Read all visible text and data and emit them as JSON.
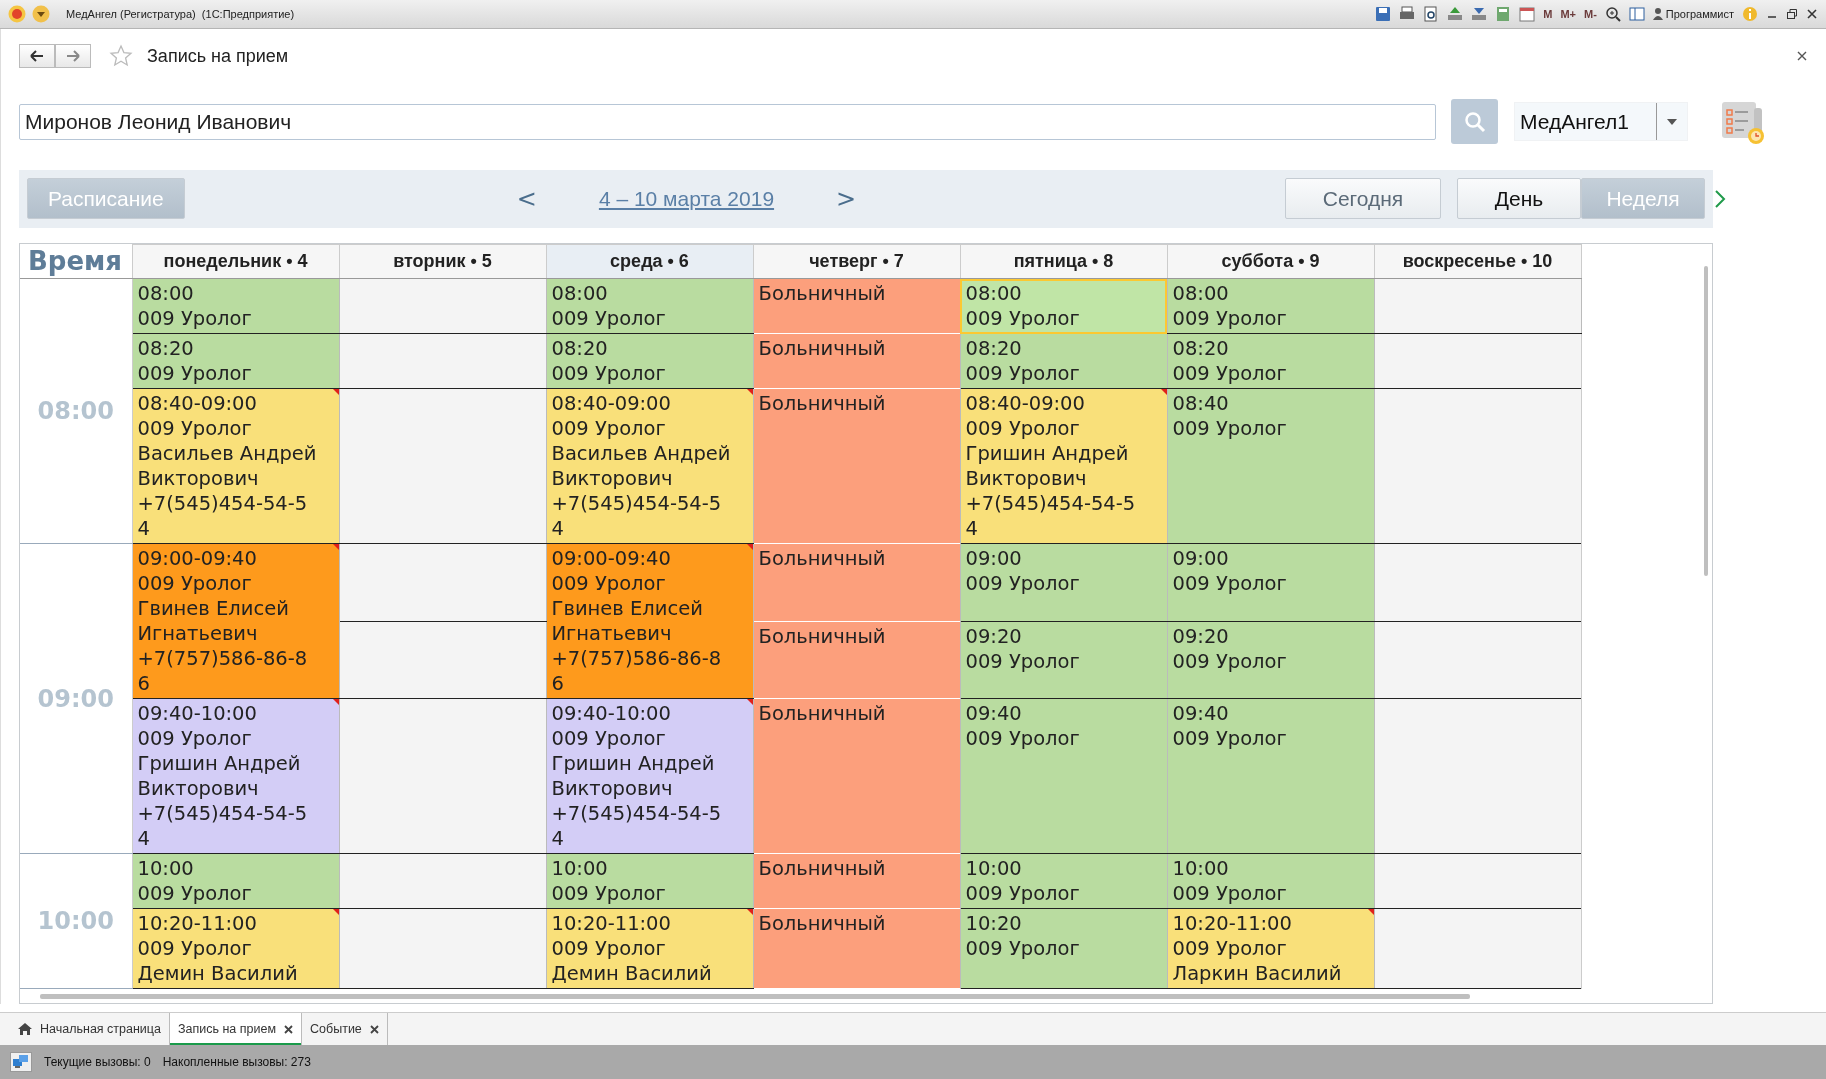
{
  "window": {
    "title": "МедАнгел (Регистратура)  (1С:Предприятие)",
    "memory_buttons": [
      "M",
      "M+",
      "M-"
    ],
    "user": "Программист"
  },
  "form": {
    "title": "Запись на прием"
  },
  "search": {
    "value": "Миронов Леонид Иванович"
  },
  "clinic": {
    "value": "МедАнгел1"
  },
  "toolbar": {
    "schedule_button": {
      "label": "Расписание",
      "pressed": true
    },
    "prev": "<",
    "period": "4 – 10 марта 2019",
    "next": ">",
    "today_button": "Сегодня",
    "views": [
      {
        "label": "День",
        "selected": false
      },
      {
        "label": "Неделя",
        "selected": true
      }
    ]
  },
  "calendar": {
    "time_header": "Время",
    "days": [
      {
        "label": "понедельник • 4",
        "today": false
      },
      {
        "label": "вторник • 5",
        "today": false
      },
      {
        "label": "среда • 6",
        "today": true
      },
      {
        "label": "четверг • 7",
        "today": false
      },
      {
        "label": "пятница • 8",
        "today": false
      },
      {
        "label": "суббота • 9",
        "today": false
      },
      {
        "label": "воскресенье • 10",
        "today": false
      }
    ],
    "rows": [
      {
        "hour": "08:00",
        "cells": [
          {
            "kind": "slot",
            "color": "#b9dca0",
            "lines": [
              "08:00",
              "009 Уролог"
            ],
            "flagged": false,
            "selected": false
          },
          {
            "kind": "empty",
            "selected": false
          },
          {
            "kind": "slot",
            "color": "#b9dca0",
            "lines": [
              "08:00",
              "009 Уролог"
            ],
            "flagged": false,
            "selected": false
          },
          {
            "kind": "absence",
            "color": "#fc9f7c",
            "lines": [
              "Больничный"
            ],
            "selected": false
          },
          {
            "kind": "slot",
            "color": "#b9dca0",
            "lines": [
              "08:00",
              "009 Уролог"
            ],
            "flagged": false,
            "selected": true
          },
          {
            "kind": "slot",
            "color": "#b9dca0",
            "lines": [
              "08:00",
              "009 Уролог"
            ],
            "flagged": false,
            "selected": false
          },
          {
            "kind": "empty",
            "selected": false
          }
        ]
      },
      {
        "cells": [
          {
            "kind": "slot",
            "color": "#b9dca0",
            "lines": [
              "08:20",
              "009 Уролог"
            ],
            "flagged": false,
            "selected": false
          },
          {
            "kind": "empty",
            "selected": false
          },
          {
            "kind": "slot",
            "color": "#b9dca0",
            "lines": [
              "08:20",
              "009 Уролог"
            ],
            "flagged": false,
            "selected": false
          },
          {
            "kind": "absence",
            "color": "#fc9f7c",
            "lines": [
              "Больничный"
            ],
            "selected": false
          },
          {
            "kind": "slot",
            "color": "#b9dca0",
            "lines": [
              "08:20",
              "009 Уролог"
            ],
            "flagged": false,
            "selected": false
          },
          {
            "kind": "slot",
            "color": "#b9dca0",
            "lines": [
              "08:20",
              "009 Уролог"
            ],
            "flagged": false,
            "selected": false
          },
          {
            "kind": "empty",
            "selected": false
          }
        ]
      },
      {
        "cells": [
          {
            "kind": "slot",
            "color": "#f9e07a",
            "lines": [
              "08:40-09:00",
              "009 Уролог",
              "Васильев Андрей",
              "Викторович",
              "+7(545)454-54-5",
              "4"
            ],
            "flagged": true,
            "selected": false
          },
          {
            "kind": "empty",
            "selected": false
          },
          {
            "kind": "slot",
            "color": "#f9e07a",
            "lines": [
              "08:40-09:00",
              "009 Уролог",
              "Васильев Андрей",
              "Викторович",
              "+7(545)454-54-5",
              "4"
            ],
            "flagged": true,
            "selected": false
          },
          {
            "kind": "absence",
            "color": "#fc9f7c",
            "lines": [
              "Больничный"
            ],
            "selected": false
          },
          {
            "kind": "slot",
            "color": "#f9e07a",
            "lines": [
              "08:40-09:00",
              "009 Уролог",
              "Гришин Андрей",
              "Викторович",
              "+7(545)454-54-5",
              "4"
            ],
            "flagged": true,
            "selected": false
          },
          {
            "kind": "slot",
            "color": "#b9dca0",
            "lines": [
              "08:40",
              "009 Уролог"
            ],
            "flagged": false,
            "selected": false
          },
          {
            "kind": "empty",
            "selected": false
          }
        ]
      },
      {
        "hour": "09:00",
        "cells": [
          {
            "kind": "slot",
            "color": "#fe9a1c",
            "lines": [
              "09:00-09:40",
              "009 Уролог",
              "Гвинев Елисей",
              "Игнатьевич",
              "+7(757)586-86-8",
              "6"
            ],
            "flagged": true,
            "rowspan": 2,
            "selected": false
          },
          {
            "kind": "empty",
            "selected": false
          },
          {
            "kind": "slot",
            "color": "#fe9a1c",
            "lines": [
              "09:00-09:40",
              "009 Уролог",
              "Гвинев Елисей",
              "Игнатьевич",
              "+7(757)586-86-8",
              "6"
            ],
            "flagged": true,
            "rowspan": 2,
            "selected": false
          },
          {
            "kind": "absence",
            "color": "#fc9f7c",
            "lines": [
              "Больничный"
            ],
            "selected": false
          },
          {
            "kind": "slot",
            "color": "#b9dca0",
            "lines": [
              "09:00",
              "009 Уролог"
            ],
            "flagged": false,
            "selected": false
          },
          {
            "kind": "slot",
            "color": "#b9dca0",
            "lines": [
              "09:00",
              "009 Уролог"
            ],
            "flagged": false,
            "selected": false
          },
          {
            "kind": "empty",
            "selected": false
          }
        ]
      },
      {
        "cells": [
          {
            "kind": "empty",
            "selected": false
          },
          {
            "kind": "absence",
            "color": "#fc9f7c",
            "lines": [
              "Больничный"
            ],
            "selected": false
          },
          {
            "kind": "slot",
            "color": "#b9dca0",
            "lines": [
              "09:20",
              "009 Уролог"
            ],
            "flagged": false,
            "selected": false
          },
          {
            "kind": "slot",
            "color": "#b9dca0",
            "lines": [
              "09:20",
              "009 Уролог"
            ],
            "flagged": false,
            "selected": false
          },
          {
            "kind": "empty",
            "selected": false
          }
        ]
      },
      {
        "cells": [
          {
            "kind": "slot",
            "color": "#d3cdf6",
            "lines": [
              "09:40-10:00",
              "009 Уролог",
              "Гришин Андрей",
              "Викторович",
              "+7(545)454-54-5",
              "4"
            ],
            "flagged": true,
            "selected": false
          },
          {
            "kind": "empty",
            "selected": false
          },
          {
            "kind": "slot",
            "color": "#d3cdf6",
            "lines": [
              "09:40-10:00",
              "009 Уролог",
              "Гришин Андрей",
              "Викторович",
              "+7(545)454-54-5",
              "4"
            ],
            "flagged": true,
            "selected": false
          },
          {
            "kind": "absence",
            "color": "#fc9f7c",
            "lines": [
              "Больничный"
            ],
            "selected": false
          },
          {
            "kind": "slot",
            "color": "#b9dca0",
            "lines": [
              "09:40",
              "009 Уролог"
            ],
            "flagged": false,
            "selected": false
          },
          {
            "kind": "slot",
            "color": "#b9dca0",
            "lines": [
              "09:40",
              "009 Уролог"
            ],
            "flagged": false,
            "selected": false
          },
          {
            "kind": "empty",
            "selected": false
          }
        ]
      },
      {
        "hour": "10:00",
        "cells": [
          {
            "kind": "slot",
            "color": "#b9dca0",
            "lines": [
              "10:00",
              "009 Уролог"
            ],
            "flagged": false,
            "selected": false
          },
          {
            "kind": "empty",
            "selected": false
          },
          {
            "kind": "slot",
            "color": "#b9dca0",
            "lines": [
              "10:00",
              "009 Уролог"
            ],
            "flagged": false,
            "selected": false
          },
          {
            "kind": "absence",
            "color": "#fc9f7c",
            "lines": [
              "Больничный"
            ],
            "selected": false
          },
          {
            "kind": "slot",
            "color": "#b9dca0",
            "lines": [
              "10:00",
              "009 Уролог"
            ],
            "flagged": false,
            "selected": false
          },
          {
            "kind": "slot",
            "color": "#b9dca0",
            "lines": [
              "10:00",
              "009 Уролог"
            ],
            "flagged": false,
            "selected": false
          },
          {
            "kind": "empty",
            "selected": false
          }
        ]
      },
      {
        "cells": [
          {
            "kind": "slot",
            "color": "#f9e07a",
            "lines": [
              "10:20-11:00",
              "009 Уролог",
              "Демин Василий"
            ],
            "flagged": true,
            "selected": false
          },
          {
            "kind": "empty",
            "selected": false
          },
          {
            "kind": "slot",
            "color": "#f9e07a",
            "lines": [
              "10:20-11:00",
              "009 Уролог",
              "Демин Василий"
            ],
            "flagged": true,
            "selected": false
          },
          {
            "kind": "absence",
            "color": "#fc9f7c",
            "lines": [
              "Больничный"
            ],
            "selected": false
          },
          {
            "kind": "slot",
            "color": "#b9dca0",
            "lines": [
              "10:20",
              "009 Уролог"
            ],
            "flagged": false,
            "selected": false
          },
          {
            "kind": "slot",
            "color": "#f9e07a",
            "lines": [
              "10:20-11:00",
              "009 Уролог",
              "Ларкин Василий"
            ],
            "flagged": true,
            "selected": false
          },
          {
            "kind": "empty",
            "selected": false
          }
        ]
      }
    ]
  },
  "tabs": [
    {
      "label": "Начальная страница",
      "kind": "home",
      "selected": false
    },
    {
      "label": "Запись на прием",
      "kind": "closable",
      "selected": true
    },
    {
      "label": "Событие",
      "kind": "closable",
      "selected": false
    }
  ],
  "status_bar": {
    "current_calls": "Текущие вызовы: 0",
    "total_calls": "Накопленные вызовы: 273"
  }
}
